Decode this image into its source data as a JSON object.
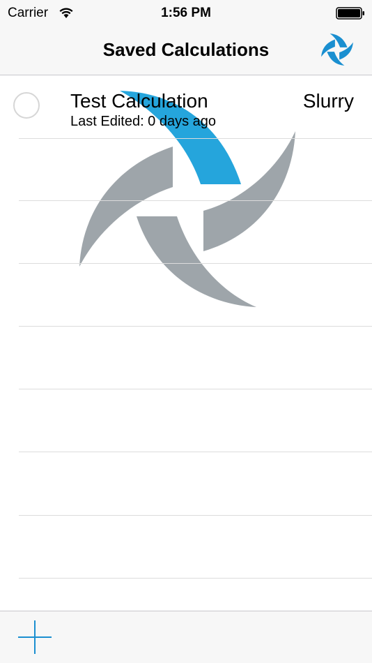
{
  "status_bar": {
    "carrier": "Carrier",
    "time": "1:56 PM"
  },
  "nav": {
    "title": "Saved Calculations",
    "logo_icon": "pinwheel-logo-icon"
  },
  "calculations": [
    {
      "title": "Test Calculation",
      "subtitle": "Last Edited: 0 days ago",
      "type": "Slurry"
    }
  ],
  "toolbar": {
    "add_icon": "plus-icon"
  },
  "colors": {
    "brand_blue": "#0096d6",
    "logo_gray": "#8e969c",
    "accent_blue": "#1a8fd0",
    "separator": "#dcdcdc",
    "bar_background": "#f7f7f7"
  }
}
